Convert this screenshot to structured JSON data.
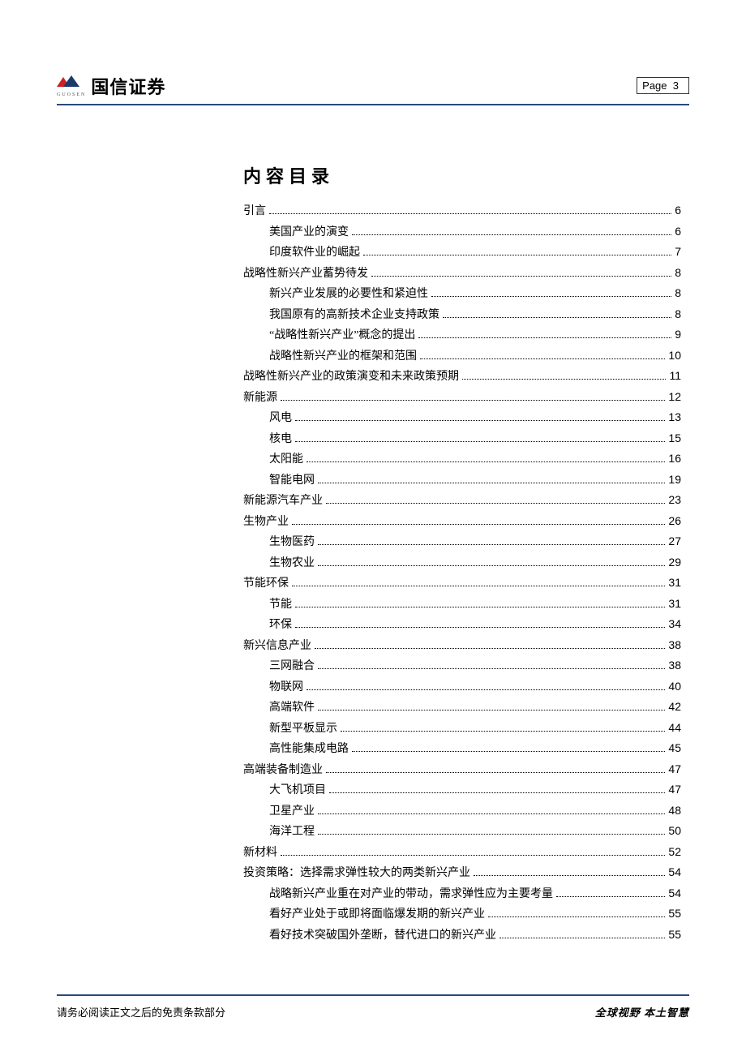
{
  "header": {
    "company": "国信证券",
    "company_sub": "GUOSEN",
    "page_label": "Page",
    "page_num": "3"
  },
  "toc": {
    "title": "内容目录",
    "items": [
      {
        "level": 1,
        "label": "引言",
        "page": "6"
      },
      {
        "level": 2,
        "label": "美国产业的演变",
        "page": "6"
      },
      {
        "level": 2,
        "label": "印度软件业的崛起",
        "page": "7"
      },
      {
        "level": 1,
        "label": "战略性新兴产业蓄势待发",
        "page": "8"
      },
      {
        "level": 2,
        "label": "新兴产业发展的必要性和紧迫性",
        "page": "8"
      },
      {
        "level": 2,
        "label": "我国原有的高新技术企业支持政策",
        "page": "8"
      },
      {
        "level": 2,
        "label": "“战略性新兴产业”概念的提出",
        "page": "9"
      },
      {
        "level": 2,
        "label": "战略性新兴产业的框架和范围",
        "page": "10"
      },
      {
        "level": 1,
        "label": "战略性新兴产业的政策演变和未来政策预期",
        "page": "11"
      },
      {
        "level": 1,
        "label": "新能源",
        "page": "12"
      },
      {
        "level": 2,
        "label": "风电",
        "page": "13"
      },
      {
        "level": 2,
        "label": "核电",
        "page": "15"
      },
      {
        "level": 2,
        "label": "太阳能",
        "page": "16"
      },
      {
        "level": 2,
        "label": "智能电网",
        "page": "19"
      },
      {
        "level": 1,
        "label": "新能源汽车产业",
        "page": "23"
      },
      {
        "level": 1,
        "label": "生物产业",
        "page": "26"
      },
      {
        "level": 2,
        "label": "生物医药",
        "page": "27"
      },
      {
        "level": 2,
        "label": "生物农业",
        "page": "29"
      },
      {
        "level": 1,
        "label": "节能环保",
        "page": "31"
      },
      {
        "level": 2,
        "label": "节能",
        "page": "31"
      },
      {
        "level": 2,
        "label": "环保",
        "page": "34"
      },
      {
        "level": 1,
        "label": "新兴信息产业",
        "page": "38"
      },
      {
        "level": 2,
        "label": "三网融合",
        "page": "38"
      },
      {
        "level": 2,
        "label": "物联网",
        "page": "40"
      },
      {
        "level": 2,
        "label": "高端软件",
        "page": "42"
      },
      {
        "level": 2,
        "label": "新型平板显示",
        "page": "44"
      },
      {
        "level": 2,
        "label": "高性能集成电路",
        "page": "45"
      },
      {
        "level": 1,
        "label": "高端装备制造业",
        "page": "47"
      },
      {
        "level": 2,
        "label": "大飞机项目",
        "page": "47"
      },
      {
        "level": 2,
        "label": "卫星产业",
        "page": "48"
      },
      {
        "level": 2,
        "label": "海洋工程",
        "page": "50"
      },
      {
        "level": 1,
        "label": "新材料",
        "page": "52"
      },
      {
        "level": 1,
        "label": "投资策略：选择需求弹性较大的两类新兴产业",
        "page": "54"
      },
      {
        "level": 2,
        "label": "战略新兴产业重在对产业的带动，需求弹性应为主要考量",
        "page": "54"
      },
      {
        "level": 2,
        "label": "看好产业处于或即将面临爆发期的新兴产业",
        "page": "55"
      },
      {
        "level": 2,
        "label": "看好技术突破国外垄断，替代进口的新兴产业",
        "page": "55"
      }
    ]
  },
  "footer": {
    "left": "请务必阅读正文之后的免责条款部分",
    "right": "全球视野  本土智慧"
  }
}
